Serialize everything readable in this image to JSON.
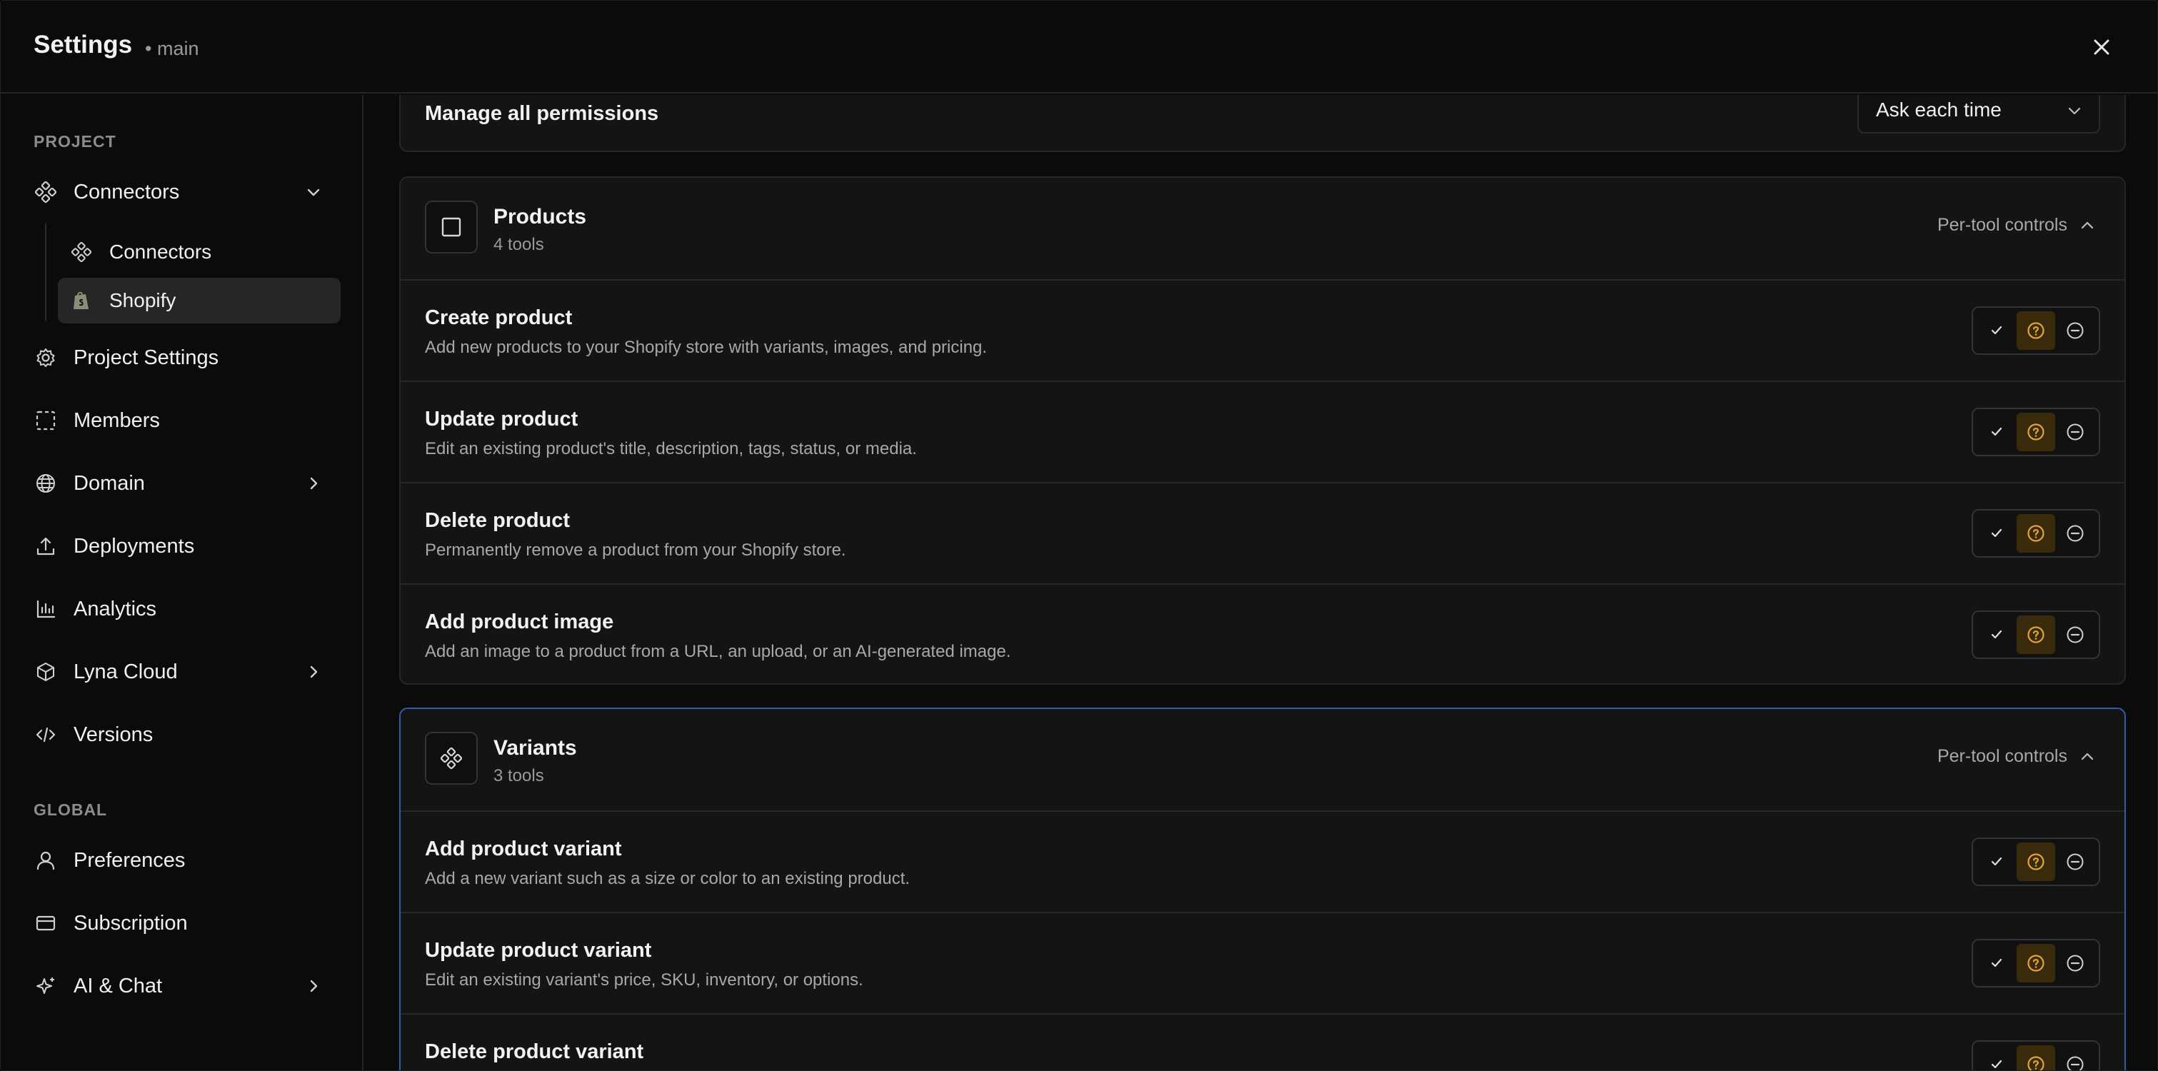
{
  "header": {
    "title": "Settings",
    "branch": "• main"
  },
  "sidebar": {
    "project_label": "PROJECT",
    "global_label": "GLOBAL",
    "connectors": {
      "label": "Connectors"
    },
    "connectors_sub": [
      {
        "label": "Connectors",
        "icon": "connector-icon"
      },
      {
        "label": "Shopify",
        "icon": "shopify-icon"
      }
    ],
    "project_items": [
      {
        "label": "Project Settings",
        "icon": "gear-icon"
      },
      {
        "label": "Members",
        "icon": "members-icon"
      },
      {
        "label": "Domain",
        "icon": "globe-icon"
      },
      {
        "label": "Deployments",
        "icon": "upload-icon"
      },
      {
        "label": "Analytics",
        "icon": "bar-chart-icon"
      },
      {
        "label": "Lyna Cloud",
        "icon": "cube-icon"
      },
      {
        "label": "Versions",
        "icon": "code-icon"
      }
    ],
    "global_items": [
      {
        "label": "Preferences",
        "icon": "user-icon"
      },
      {
        "label": "Subscription",
        "icon": "card-icon"
      },
      {
        "label": "AI & Chat",
        "icon": "sparkle-icon"
      }
    ]
  },
  "main": {
    "manage_all": {
      "label": "Manage all permissions",
      "value": "Ask each time"
    },
    "groups": [
      {
        "title": "Products",
        "count": "4 tools",
        "control_label": "Per-tool controls",
        "tools": [
          {
            "title": "Create product",
            "desc": "Add new products to your Shopify store with variants, images, and pricing."
          },
          {
            "title": "Update product",
            "desc": "Edit an existing product's title, description, tags, status, or media."
          },
          {
            "title": "Delete product",
            "desc": "Permanently remove a product from your Shopify store."
          },
          {
            "title": "Add product image",
            "desc": "Add an image to a product from a URL, an upload, or an AI-generated image."
          }
        ]
      },
      {
        "title": "Variants",
        "count": "3 tools",
        "control_label": "Per-tool controls",
        "tools": [
          {
            "title": "Add product variant",
            "desc": "Add a new variant such as a size or color to an existing product."
          },
          {
            "title": "Update product variant",
            "desc": "Edit an existing variant's price, SKU, inventory, or options."
          },
          {
            "title": "Delete product variant",
            "desc": ""
          }
        ]
      }
    ],
    "permission_selected": "ask",
    "colors": {
      "accent_ask": "#e0a33a",
      "highlight_border": "#2f5ea8"
    }
  }
}
